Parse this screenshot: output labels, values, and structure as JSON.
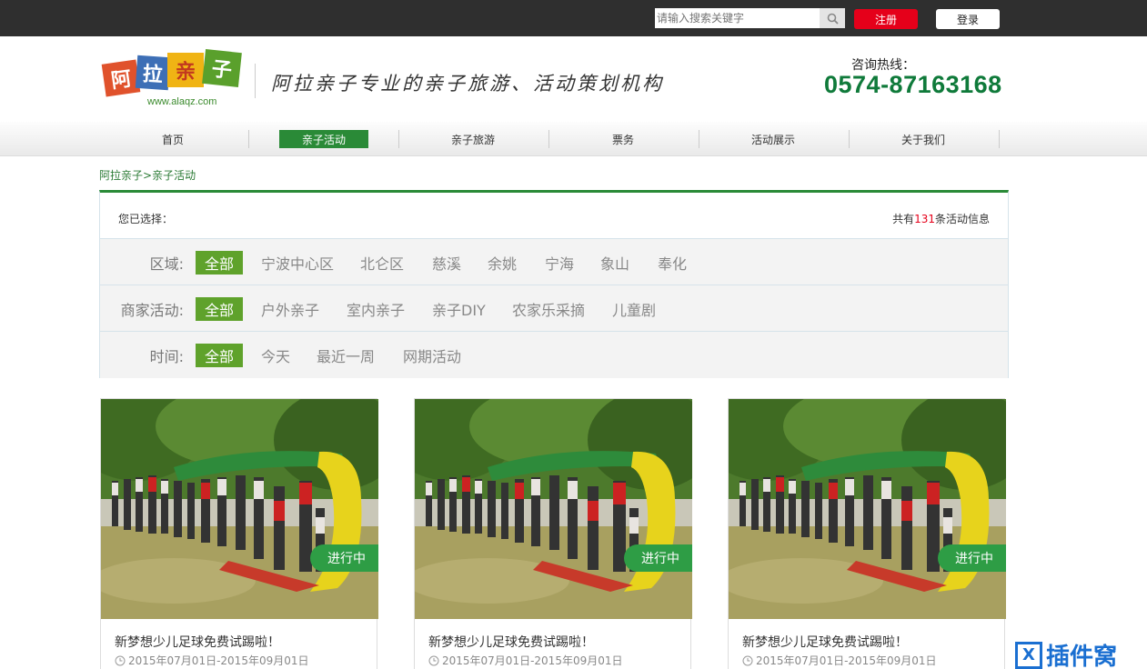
{
  "topbar": {
    "search_placeholder": "请输入搜索关键字",
    "register_label": "注册",
    "login_label": "登录"
  },
  "header": {
    "logo_chars": [
      "阿",
      "拉",
      "亲",
      "子"
    ],
    "logo_url": "www.alaqz.com",
    "slogan": "阿拉亲子专业的亲子旅游、活动策划机构",
    "hotline_label": "咨询热线：",
    "hotline_number": "0574-87163168"
  },
  "nav": {
    "items": [
      {
        "label": "首页"
      },
      {
        "label": "亲子活动"
      },
      {
        "label": "亲子旅游"
      },
      {
        "label": "票务"
      },
      {
        "label": "活动展示"
      },
      {
        "label": "关于我们"
      }
    ]
  },
  "breadcrumb": {
    "home": "阿拉亲子",
    "sep": ">",
    "current": "亲子活动"
  },
  "filter": {
    "selected_label": "您已选择：",
    "total_prefix": "共有",
    "total_count": "131",
    "total_suffix": "条活动信息",
    "rows": [
      {
        "label": "区域:",
        "options": [
          "全部",
          "宁波中心区",
          "北仑区",
          "慈溪",
          "余姚",
          "宁海",
          "象山",
          "奉化"
        ]
      },
      {
        "label": "商家活动:",
        "options": [
          "全部",
          "户外亲子",
          "室内亲子",
          "亲子DIY",
          "农家乐采摘",
          "儿童剧"
        ]
      },
      {
        "label": "时间:",
        "options": [
          "全部",
          "今天",
          "最近一周",
          "网期活动"
        ]
      }
    ]
  },
  "cards": [
    {
      "status": "进行中",
      "title": "新梦想少儿足球免费试踢啦！",
      "date": "2015年07月01日-2015年09月01日"
    },
    {
      "status": "进行中",
      "title": "新梦想少儿足球免费试踢啦！",
      "date": "2015年07月01日-2015年09月01日"
    },
    {
      "status": "进行中",
      "title": "新梦想少儿足球免费试踢啦！",
      "date": "2015年07月01日-2015年09月01日"
    }
  ],
  "watermark": {
    "box_char": "X",
    "text": "插件窝"
  },
  "colors": {
    "brand_green": "#2a8a37",
    "filter_active": "#5fa22b",
    "register_red": "#e5001a",
    "hotline_green": "#0f7a3a"
  }
}
